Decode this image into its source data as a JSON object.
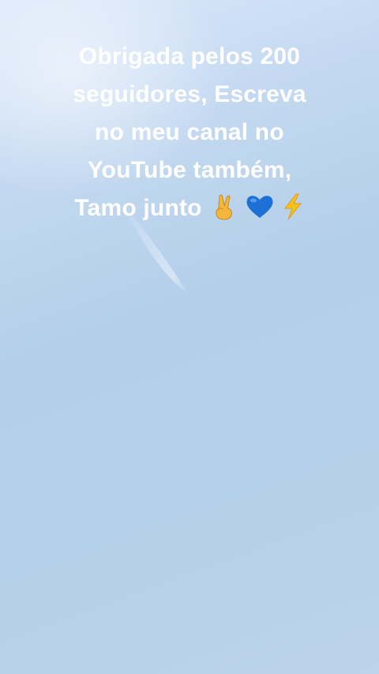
{
  "caption": {
    "lines": [
      "Obrigada pelos 200",
      "seguidores, Escreva",
      "no meu canal no",
      "YouTube também,",
      "Tamo junto"
    ]
  },
  "emojis": [
    "victory-hand-icon",
    "blue-heart-icon",
    "lightning-icon"
  ],
  "colors": {
    "background_top": "#dce9fb",
    "background_bottom": "#bdd2ec",
    "text": "#ffffff",
    "heart": "#1e6fd6",
    "lightning": "#f5c21b",
    "hand": "#f4b63c"
  }
}
